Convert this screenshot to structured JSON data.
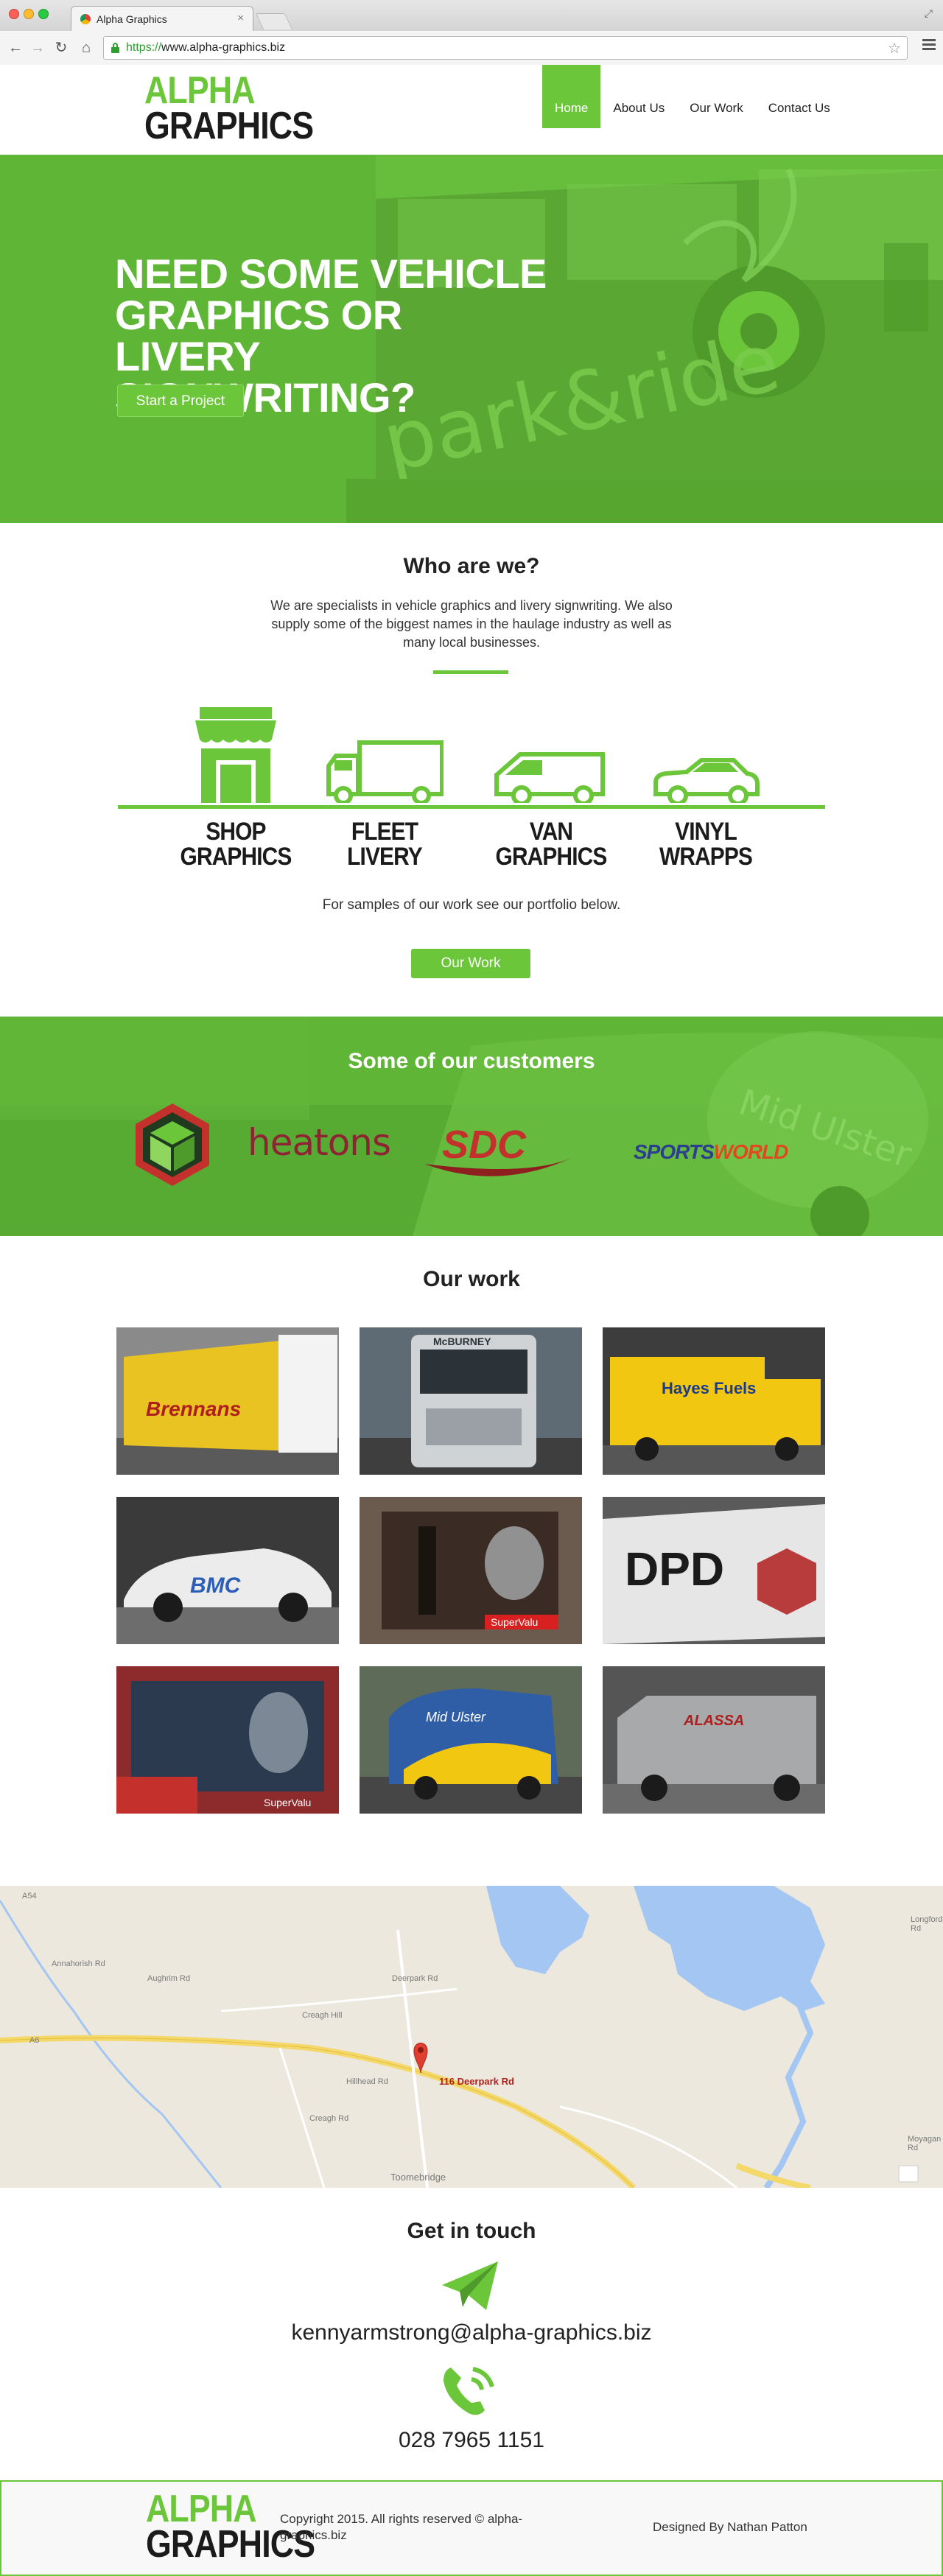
{
  "browser": {
    "tab_title": "Alpha Graphics",
    "tab_close": "×",
    "url_scheme": "https://",
    "url_rest": "www.alpha-graphics.biz",
    "icons": [
      "back-icon",
      "forward-icon",
      "reload-icon",
      "home-icon",
      "lock-icon",
      "star-icon",
      "menu-icon"
    ]
  },
  "header": {
    "logo_line1": "ALPHA",
    "logo_line2": "GRAPHICS",
    "nav": [
      {
        "label": "Home",
        "active": true
      },
      {
        "label": "About Us",
        "active": false
      },
      {
        "label": "Our Work",
        "active": false
      },
      {
        "label": "Contact Us",
        "active": false
      }
    ]
  },
  "hero": {
    "title": "NEED SOME VEHICLE GRAPHICS OR LIVERY SIGNWRITING?",
    "button": "Start a Project",
    "bg_text": "park&ride"
  },
  "about": {
    "title": "Who are we?",
    "text": "We are specialists in vehicle graphics and livery signwriting.  We also supply some of the biggest names in the haulage industry as well as many local businesses.",
    "services": [
      {
        "label_line1": "SHOP",
        "label_line2": "GRAPHICS",
        "icon": "shop-icon"
      },
      {
        "label_line1": "FLEET",
        "label_line2": "LIVERY",
        "icon": "truck-icon"
      },
      {
        "label_line1": "VAN",
        "label_line2": "GRAPHICS",
        "icon": "van-icon"
      },
      {
        "label_line1": "VINYL",
        "label_line2": "WRAPPS",
        "icon": "car-icon"
      }
    ],
    "samples_text": "For samples of our work see our portfolio below.",
    "button": "Our Work"
  },
  "customers": {
    "title": "Some of our customers",
    "logos": [
      "heatons",
      "SDC",
      "SPORTSWORLD"
    ],
    "heatons": "heatons",
    "sdc": "SDC",
    "sportsworld_1": "SPORTS",
    "sportsworld_2": "WORLD",
    "bg_text": "Mid Ulster"
  },
  "work": {
    "title": "Our work",
    "items": [
      {
        "caption": "Brennans",
        "bg": "#e9c321"
      },
      {
        "caption": "McBURNEY",
        "bg": "#b9bcbf"
      },
      {
        "caption": "Hayes Fuels",
        "bg": "#f1c712"
      },
      {
        "caption": "BMC",
        "bg": "#ececec"
      },
      {
        "caption": "SuperValu",
        "bg": "#6b5a4e"
      },
      {
        "caption": "DPD",
        "bg": "#e6e6e6"
      },
      {
        "caption": "SuperValu",
        "bg": "#8c2a2c"
      },
      {
        "caption": "Mid Ulster",
        "bg": "#2f5ea6"
      },
      {
        "caption": "ALASSA",
        "bg": "#a8a9ab"
      }
    ]
  },
  "map": {
    "address": "116 Deerpark Rd",
    "places": [
      "Toomebridge",
      "Creagh Hill",
      "Deerpark Rd",
      "Hillhead Rd",
      "Creagh Rd",
      "Annahorish Rd",
      "Aughrim Rd",
      "Longford Rd",
      "Moyagan Rd",
      "A6",
      "A54"
    ]
  },
  "contact": {
    "title": "Get in touch",
    "email": "kennyarmstrong@alpha-graphics.biz",
    "phone": "028 7965 1151"
  },
  "footer": {
    "copyright": "Copyright 2015. All rights reserved © alpha-graphics.biz",
    "designed_by": "Designed By Nathan Patton"
  },
  "colors": {
    "brand_green": "#6bc639",
    "hero_green": "#5fb536",
    "dark": "#1b1b1b"
  }
}
